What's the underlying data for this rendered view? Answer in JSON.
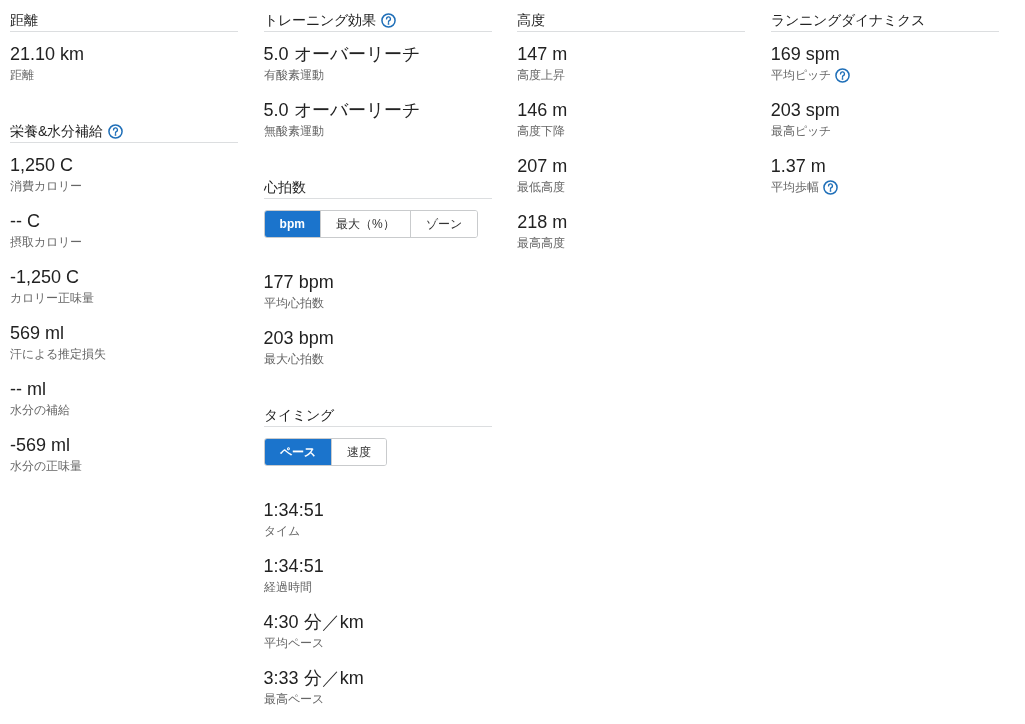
{
  "columns": [
    {
      "sections": [
        {
          "title": "距離",
          "stats": [
            {
              "value": "21.10 km",
              "label": "距離"
            }
          ]
        },
        {
          "title": "栄養&水分補給",
          "help": true,
          "stats": [
            {
              "value": "1,250 C",
              "label": "消費カロリー"
            },
            {
              "value": "-- C",
              "label": "摂取カロリー"
            },
            {
              "value": "-1,250 C",
              "label": "カロリー正味量"
            },
            {
              "value": "569 ml",
              "label": "汗による推定損失"
            },
            {
              "value": "-- ml",
              "label": "水分の補給"
            },
            {
              "value": "-569 ml",
              "label": "水分の正味量"
            }
          ]
        }
      ]
    },
    {
      "sections": [
        {
          "title": "トレーニング効果",
          "help": true,
          "stats": [
            {
              "value": "5.0 オーバーリーチ",
              "label": "有酸素運動"
            },
            {
              "value": "5.0 オーバーリーチ",
              "label": "無酸素運動"
            }
          ]
        },
        {
          "title": "心拍数",
          "toggle": [
            {
              "label": "bpm",
              "selected": true
            },
            {
              "label": "最大（%）",
              "selected": false
            },
            {
              "label": "ゾーン",
              "selected": false
            }
          ],
          "stats": [
            {
              "value": "177 bpm",
              "label": "平均心拍数"
            },
            {
              "value": "203 bpm",
              "label": "最大心拍数"
            }
          ]
        },
        {
          "title": "タイミング",
          "toggle": [
            {
              "label": "ペース",
              "selected": true
            },
            {
              "label": "速度",
              "selected": false
            }
          ],
          "stats": [
            {
              "value": "1:34:51",
              "label": "タイム"
            },
            {
              "value": "1:34:51",
              "label": "経過時間"
            },
            {
              "value": "4:30 分／km",
              "label": "平均ペース"
            },
            {
              "value": "3:33 分／km",
              "label": "最高ペース"
            }
          ]
        }
      ]
    },
    {
      "sections": [
        {
          "title": "高度",
          "stats": [
            {
              "value": "147 m",
              "label": "高度上昇"
            },
            {
              "value": "146 m",
              "label": "高度下降"
            },
            {
              "value": "207 m",
              "label": "最低高度"
            },
            {
              "value": "218 m",
              "label": "最高高度"
            }
          ]
        }
      ]
    },
    {
      "sections": [
        {
          "title": "ランニングダイナミクス",
          "stats": [
            {
              "value": "169 spm",
              "label": "平均ピッチ",
              "help": true
            },
            {
              "value": "203 spm",
              "label": "最高ピッチ"
            },
            {
              "value": "1.37 m",
              "label": "平均歩幅",
              "help": true
            }
          ]
        }
      ]
    }
  ]
}
